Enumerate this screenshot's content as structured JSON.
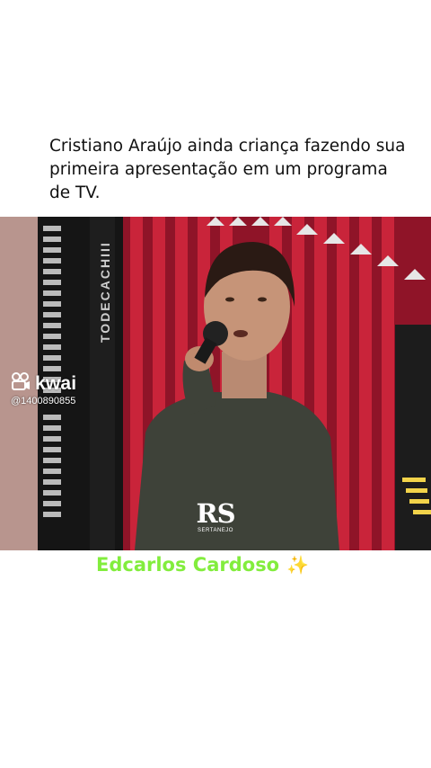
{
  "post": {
    "caption": "Cristiano Araújo ainda criança fazendo sua primeira apresentação em um programa de TV."
  },
  "video": {
    "watermark_app": "kwai",
    "watermark_user": "@1400890855",
    "channel_logo": "RS",
    "channel_logo_sub": "SERTANEJO",
    "backdrop_text": "TODECACHIII"
  },
  "overlay": {
    "credit": "Edcarlos Cardoso",
    "credit_emoji": "✨"
  },
  "colors": {
    "credit_green": "#82ed3d",
    "accordion_red": "#c9243a"
  }
}
